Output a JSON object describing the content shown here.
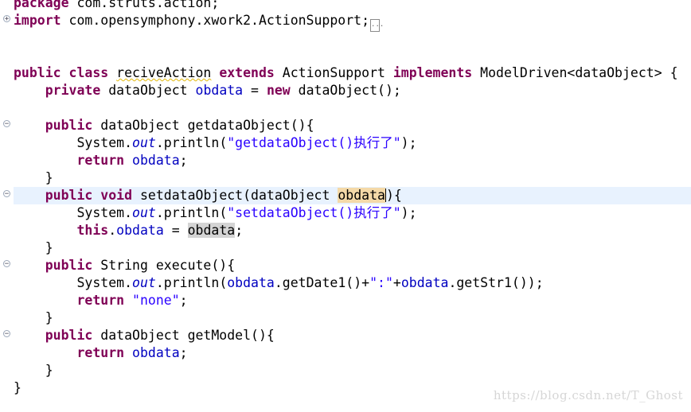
{
  "code": {
    "l1": {
      "kw": "package",
      "rest": " com.struts.action;"
    },
    "l2": {
      "kw": "import",
      "rest": " com.opensymphony.xwork2.ActionSupport;",
      "fold_box": "..."
    },
    "l3": {
      "kw1": "public",
      "kw2": "class",
      "classname": "reciveAction",
      "kw3": "extends",
      "t1": "ActionSupport",
      "kw4": "implements",
      "t2": "ModelDriven<dataObject> {"
    },
    "l4": {
      "kw1": "private",
      "t1": " dataObject ",
      "field": "obdata",
      "t2": " = ",
      "kw2": "new",
      "t3": " dataObject();"
    },
    "l5": {
      "kw": "public",
      "t": " dataObject getdataObject(){"
    },
    "l6": {
      "t1": "System.",
      "st": "out",
      "t2": ".println(",
      "str": "\"getdataObject()执行了\"",
      "t3": ");"
    },
    "l7": {
      "kw": "return",
      "field": "obdata",
      "t": ";"
    },
    "l8": {
      "t": "}"
    },
    "l9": {
      "kw1": "public",
      "kw2": "void",
      "t1": " setdataObject(dataObject ",
      "param": "obdata",
      "t2": "){"
    },
    "l10": {
      "t1": "System.",
      "st": "out",
      "t2": ".println(",
      "str": "\"setdataObject()执行了\"",
      "t3": ");"
    },
    "l11": {
      "kw": "this",
      "t1": ".",
      "field": "obdata",
      "t2": " = ",
      "param": "obdata",
      "t3": ";"
    },
    "l12": {
      "t": "}"
    },
    "l13": {
      "kw": "public",
      "t": " String execute(){"
    },
    "l14": {
      "t1": "System.",
      "st": "out",
      "t2": ".println(",
      "f1": "obdata",
      "t3": ".getDate1()+",
      "str": "\":\"",
      "t4": "+",
      "f2": "obdata",
      "t5": ".getStr1());"
    },
    "l15": {
      "kw": "return",
      "str": "\"none\"",
      "t": ";"
    },
    "l16": {
      "t": "}"
    },
    "l17": {
      "kw": "public",
      "t": " dataObject getModel(){"
    },
    "l18": {
      "kw": "return",
      "field": "obdata",
      "t": ";"
    },
    "l19": {
      "t": "}"
    },
    "l20": {
      "t": "}"
    }
  },
  "gutter": {
    "expand_glyph": "+",
    "collapse_glyph": "−"
  },
  "watermark": "https://blog.csdn.net/T_Ghost",
  "colors": {
    "keyword": "#7f0055",
    "field": "#0000c0",
    "string": "#2a00ff",
    "current_line": "#e8f2fe",
    "occurrence": "#d4d4d4",
    "write_occurrence": "#f4d9a8"
  }
}
